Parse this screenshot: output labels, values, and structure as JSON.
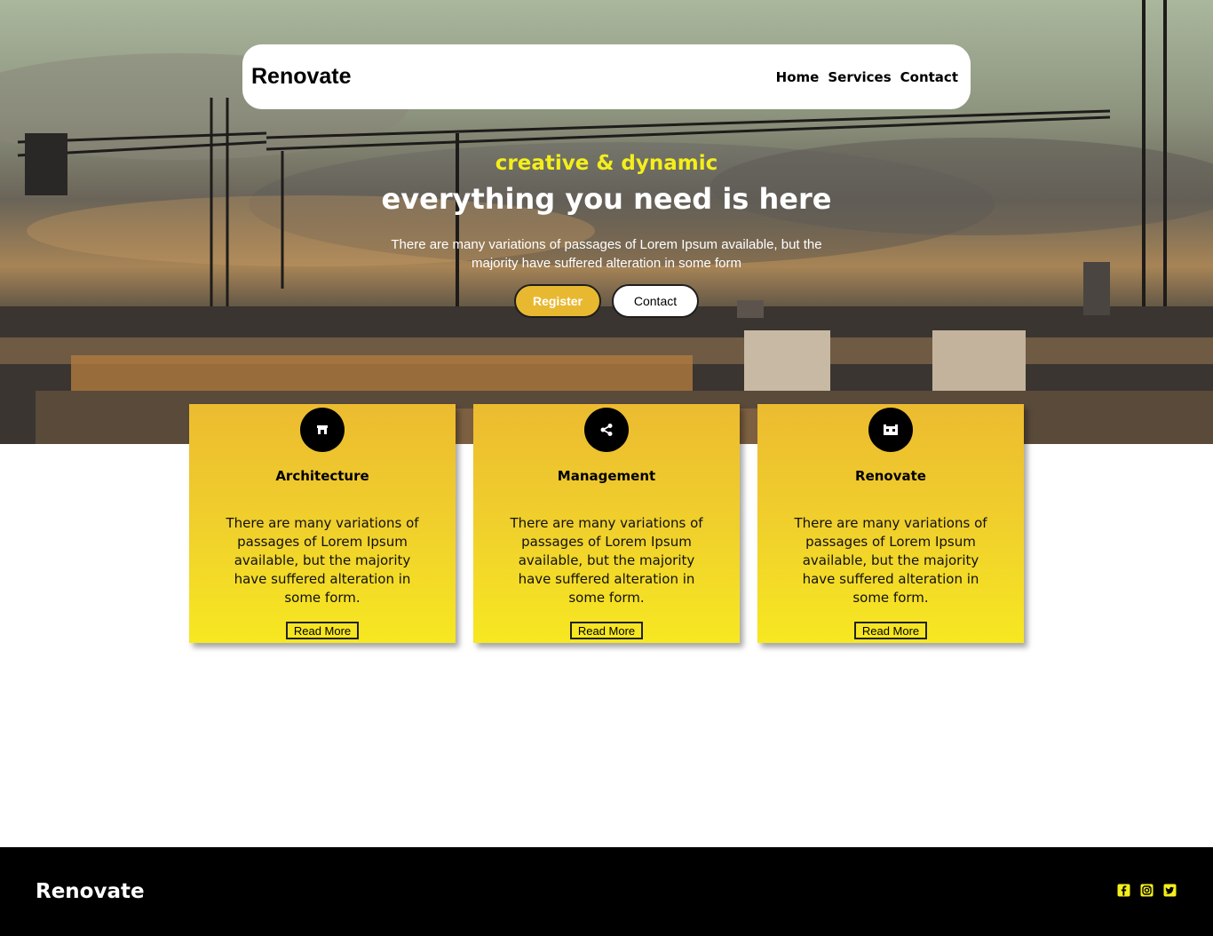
{
  "colors": {
    "accent": "#e8b830",
    "tagline": "#f4ef1b",
    "card_top": "#ecbb30",
    "card_bottom": "#f7e821",
    "footer_bg": "#000000"
  },
  "nav": {
    "brand": "Renovate",
    "links": [
      "Home",
      "Services",
      "Contact"
    ]
  },
  "hero": {
    "tagline": "creative & dynamic",
    "headline": "everything you need is here",
    "description": "There are many variations of passages of Lorem Ipsum available, but the majority have suffered alteration in some form",
    "register_label": "Register",
    "contact_label": "Contact"
  },
  "cards": [
    {
      "icon": "store-icon",
      "title": "Architecture",
      "text": "There are many variations of passages of Lorem Ipsum available, but the majority have suffered alteration in some form.",
      "button": "Read More"
    },
    {
      "icon": "share-icon",
      "title": "Management",
      "text": "There are many variations of passages of Lorem Ipsum available, but the majority have suffered alteration in some form.",
      "button": "Read More"
    },
    {
      "icon": "industry-icon",
      "title": "Renovate",
      "text": "There are many variations of passages of Lorem Ipsum available, but the majority have suffered alteration in some form.",
      "button": "Read More"
    }
  ],
  "footer": {
    "brand": "Renovate",
    "social": [
      "facebook-icon",
      "instagram-icon",
      "twitter-icon"
    ]
  }
}
